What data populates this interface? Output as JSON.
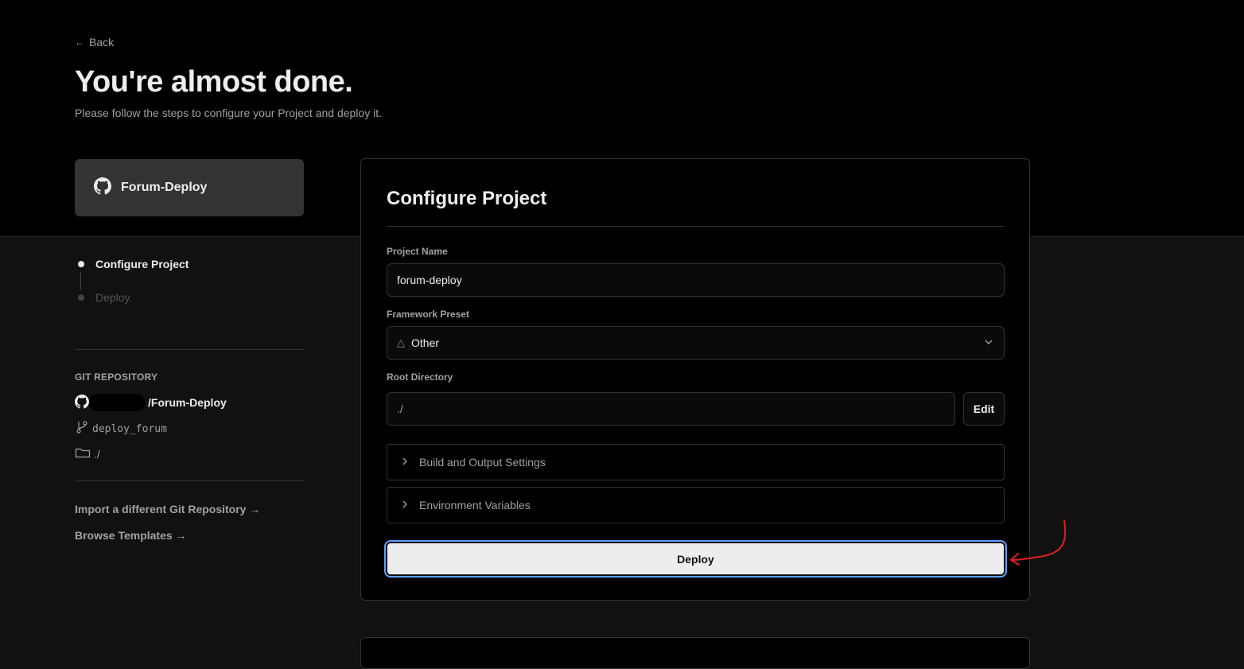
{
  "header": {
    "back_label": "Back",
    "title": "You're almost done.",
    "subtitle": "Please follow the steps to configure your Project and deploy it."
  },
  "repo_card": {
    "name": "Forum-Deploy",
    "icon": "github-icon"
  },
  "steps": [
    {
      "label": "Configure Project",
      "state": "active"
    },
    {
      "label": "Deploy",
      "state": "inactive"
    }
  ],
  "git": {
    "section_label": "GIT REPOSITORY",
    "repo_name": "/Forum-Deploy",
    "branch": "deploy_forum",
    "directory": "./"
  },
  "links": {
    "import_repo": "Import a different Git Repository →",
    "browse_templates": "Browse Templates →"
  },
  "configure": {
    "title": "Configure Project",
    "project_name_label": "Project Name",
    "project_name_value": "forum-deploy",
    "framework_label": "Framework Preset",
    "framework_value": "Other",
    "root_dir_label": "Root Directory",
    "root_dir_value": "./",
    "edit_label": "Edit",
    "build_settings_label": "Build and Output Settings",
    "env_vars_label": "Environment Variables",
    "deploy_label": "Deploy"
  },
  "colors": {
    "background": "#111111",
    "top_band": "#000000",
    "deploy_focus_ring": "#5fa0ff",
    "annotation": "#e02020"
  }
}
